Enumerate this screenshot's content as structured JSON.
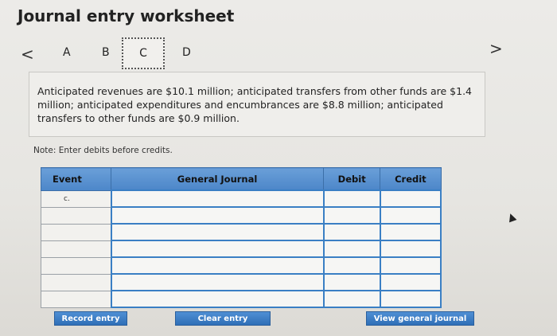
{
  "page": {
    "title": "Journal entry worksheet"
  },
  "nav": {
    "prev": "<",
    "next": ">",
    "tabs": [
      "A",
      "B",
      "C",
      "D"
    ],
    "active_tab": "C"
  },
  "description": "Anticipated revenues are $10.1 million; anticipated transfers from other funds are $1.4 million; anticipated expenditures and encumbrances are $8.8 million; anticipated transfers to other funds are $0.9 million.",
  "note": "Note: Enter debits before credits.",
  "table": {
    "headers": {
      "event": "Event",
      "journal": "General Journal",
      "debit": "Debit",
      "credit": "Credit"
    },
    "rows": [
      {
        "event": "c.",
        "journal": "",
        "debit": "",
        "credit": ""
      },
      {
        "event": "",
        "journal": "",
        "debit": "",
        "credit": ""
      },
      {
        "event": "",
        "journal": "",
        "debit": "",
        "credit": ""
      },
      {
        "event": "",
        "journal": "",
        "debit": "",
        "credit": ""
      },
      {
        "event": "",
        "journal": "",
        "debit": "",
        "credit": ""
      },
      {
        "event": "",
        "journal": "",
        "debit": "",
        "credit": ""
      },
      {
        "event": "",
        "journal": "",
        "debit": "",
        "credit": ""
      }
    ]
  },
  "buttons": {
    "record": "Record entry",
    "clear": "Clear entry",
    "view": "View general journal"
  },
  "colors": {
    "header_blue": "#4c86c9",
    "button_blue": "#2f6fb7",
    "input_border": "#3a7fc4"
  }
}
